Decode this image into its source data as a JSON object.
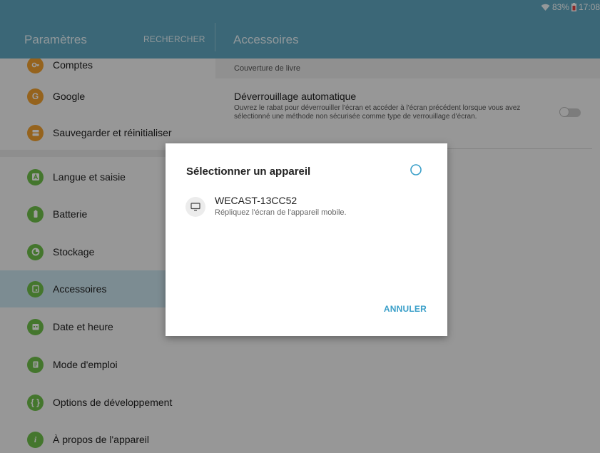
{
  "status_bar": {
    "battery": "83%",
    "time": "17:08"
  },
  "header": {
    "title": "Paramètres",
    "search": "RECHERCHER",
    "page_title": "Accessoires"
  },
  "sidebar": {
    "items": [
      {
        "label": "Comptes",
        "icon": "key-icon",
        "color": "#f0a030"
      },
      {
        "label": "Google",
        "icon": "google-icon",
        "color": "#f0a030"
      },
      {
        "label": "Sauvegarder et réinitialiser",
        "icon": "backup-icon",
        "color": "#f0a030"
      },
      {
        "label": "Langue et saisie",
        "icon": "language-icon",
        "color": "#6fbf4a"
      },
      {
        "label": "Batterie",
        "icon": "battery-icon",
        "color": "#6fbf4a"
      },
      {
        "label": "Stockage",
        "icon": "storage-icon",
        "color": "#6fbf4a"
      },
      {
        "label": "Accessoires",
        "icon": "accessories-icon",
        "color": "#6fbf4a",
        "active": true
      },
      {
        "label": "Date et heure",
        "icon": "calendar-icon",
        "color": "#6fbf4a"
      },
      {
        "label": "Mode d'emploi",
        "icon": "manual-icon",
        "color": "#6fbf4a"
      },
      {
        "label": "Options de développement",
        "icon": "developer-icon",
        "color": "#6fbf4a"
      },
      {
        "label": "À propos de l'appareil",
        "icon": "info-icon",
        "color": "#6fbf4a"
      }
    ]
  },
  "content": {
    "section_header": "Couverture de livre",
    "auto_unlock": {
      "title": "Déverrouillage automatique",
      "description": "Ouvrez le rabat pour déverrouiller l'écran et accéder à l'écran précédent lorsque vous avez sélectionné une méthode non sécurisée comme type de verrouillage d'écran.",
      "enabled": false
    }
  },
  "dialog": {
    "title": "Sélectionner un appareil",
    "device_name": "WECAST-13CC52",
    "device_subtitle": "Répliquez l'écran de l'appareil mobile.",
    "cancel": "ANNULER"
  },
  "colors": {
    "header": "#5fa7c0",
    "accent": "#3a9fc9",
    "active_item": "#c9e2ec"
  }
}
